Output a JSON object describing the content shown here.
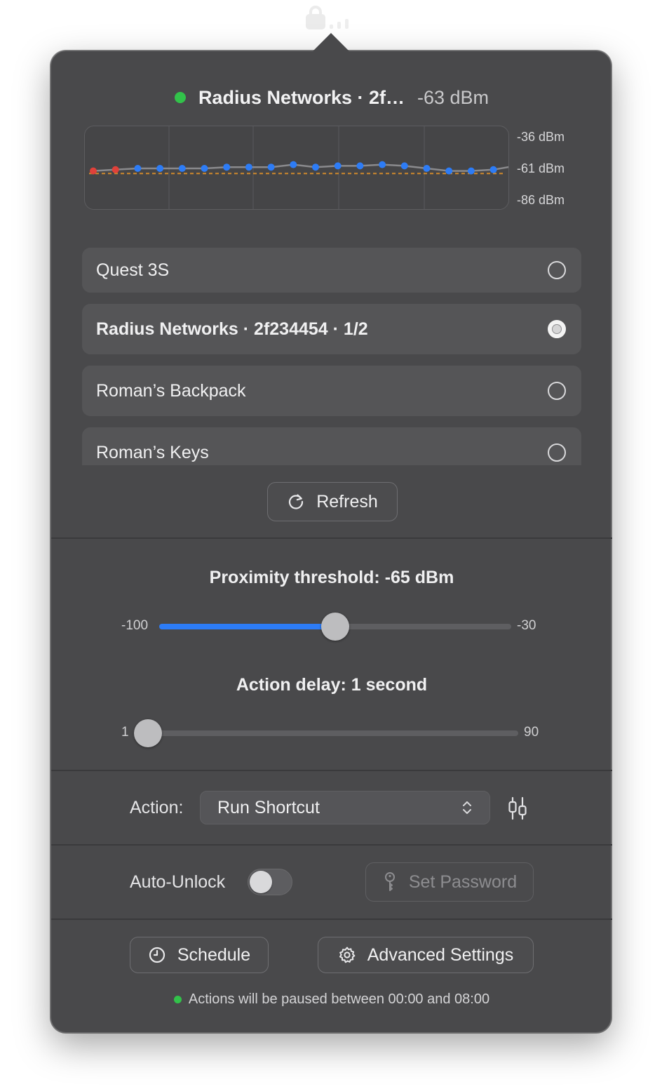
{
  "header": {
    "device_name": "Radius Networks · 2f…",
    "rssi": "-63 dBm",
    "status_color": "#32c24a"
  },
  "chart_data": {
    "type": "line",
    "ylabels": [
      "-36 dBm",
      "-61 dBm",
      "-86 dBm"
    ],
    "ylim": [
      -86,
      -36
    ],
    "threshold": -65,
    "values": [
      -63,
      -62,
      -61,
      -61,
      -61,
      -61,
      -60,
      -60,
      -60,
      -58,
      -60,
      -59,
      -59,
      -58,
      -59,
      -61,
      -63,
      -63,
      -62
    ],
    "above_color": "#2d7cf6",
    "below_color": "#e0413a",
    "threshold_color": "#d08a2c"
  },
  "devices": [
    {
      "name": "Quest 3S",
      "selected": false
    },
    {
      "name": "Radius Networks · 2f234454 · 1/2",
      "selected": true
    },
    {
      "name": "Roman’s Backpack",
      "selected": false
    },
    {
      "name": "Roman’s Keys",
      "selected": false
    }
  ],
  "buttons": {
    "refresh": "Refresh",
    "set_password": "Set Password",
    "schedule": "Schedule",
    "advanced": "Advanced Settings"
  },
  "proximity": {
    "title": "Proximity threshold: -65 dBm",
    "min": "-100",
    "max": "-30",
    "value": -65,
    "accent": "#2d7cf6"
  },
  "delay": {
    "title": "Action delay: 1 second",
    "min": "1",
    "max": "90",
    "value": 1
  },
  "action": {
    "label": "Action:",
    "selected": "Run Shortcut"
  },
  "auto_unlock": {
    "label": "Auto-Unlock",
    "enabled": false
  },
  "footer": {
    "note": "Actions will be paused between 00:00 and 08:00"
  }
}
